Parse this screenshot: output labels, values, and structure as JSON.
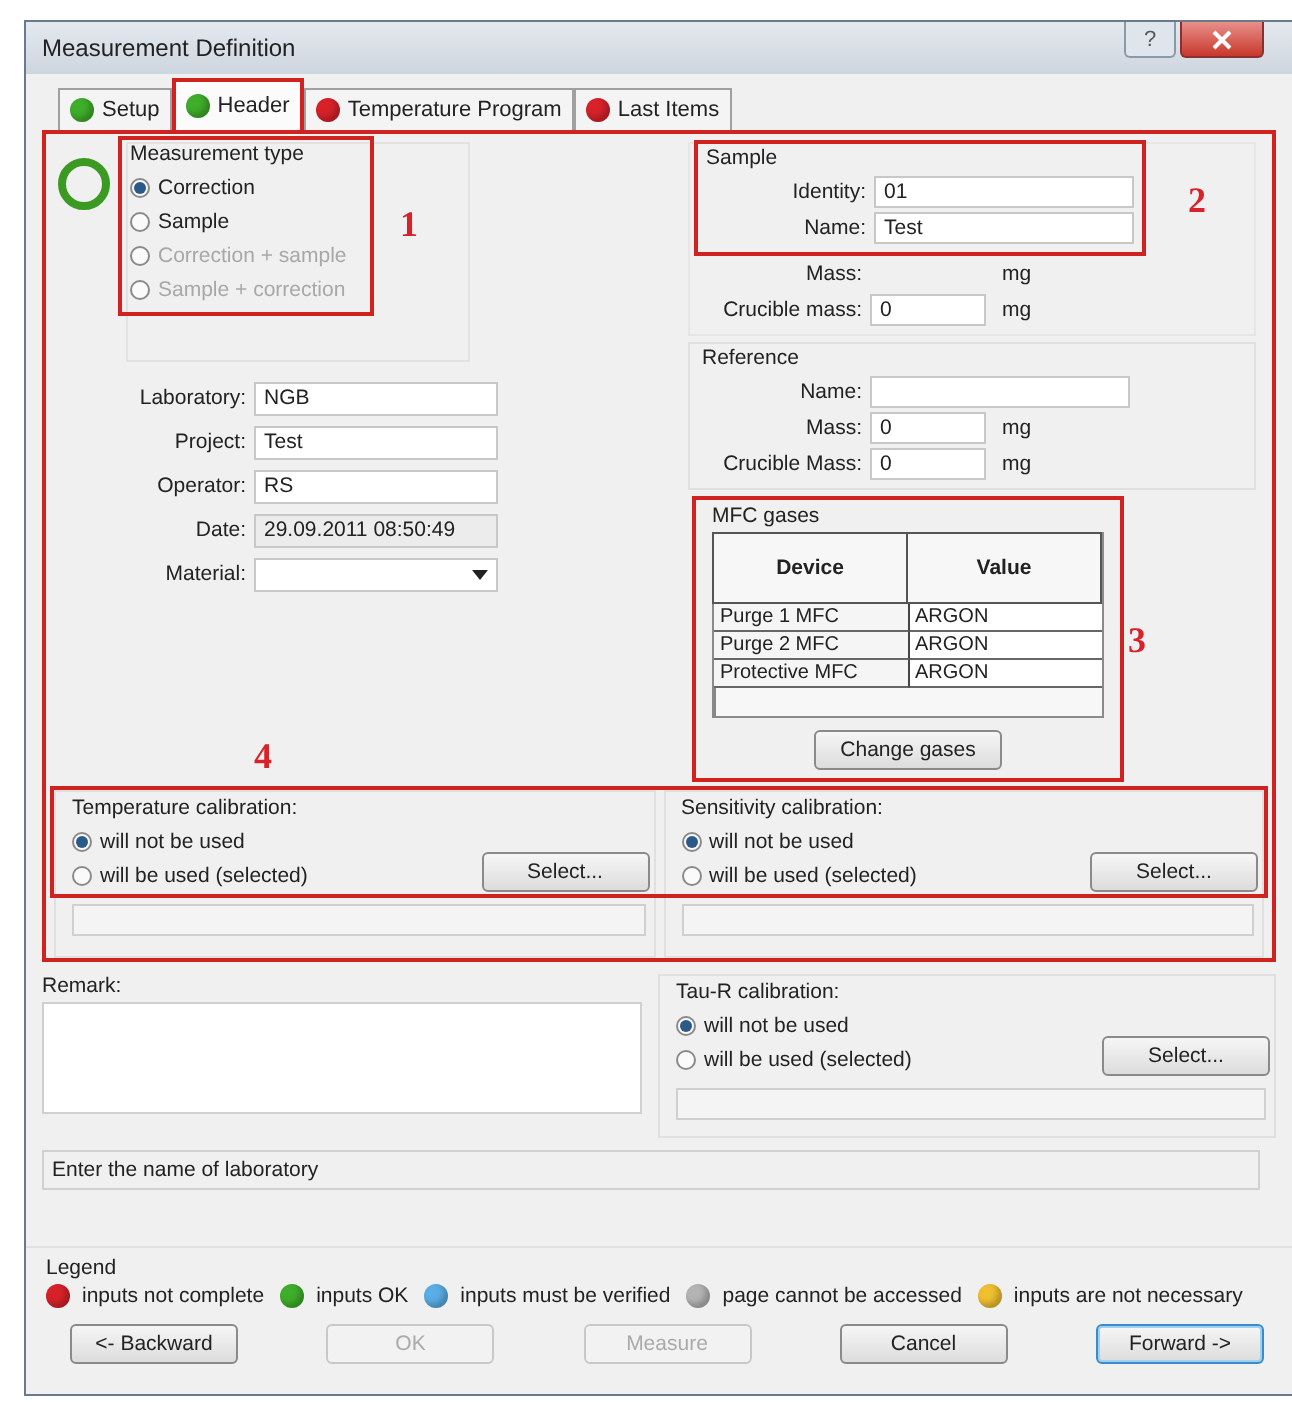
{
  "window": {
    "title": "Measurement Definition",
    "help": "?"
  },
  "tabs": [
    {
      "label": "Setup",
      "selected": false,
      "color": "#3fae2a"
    },
    {
      "label": "Header",
      "selected": true,
      "color": "#3fae2a"
    },
    {
      "label": "Temperature Program",
      "selected": false,
      "color": "#d8222a"
    },
    {
      "label": "Last Items",
      "selected": false,
      "color": "#d8222a"
    }
  ],
  "measurement_type": {
    "title": "Measurement type",
    "annotation": "1",
    "options": [
      {
        "label": "Correction",
        "selected": true,
        "disabled": false
      },
      {
        "label": "Sample",
        "selected": false,
        "disabled": false
      },
      {
        "label": "Correction + sample",
        "selected": false,
        "disabled": true
      },
      {
        "label": "Sample + correction",
        "selected": false,
        "disabled": true
      }
    ]
  },
  "header_fields": [
    {
      "label": "Laboratory:",
      "value": "NGB",
      "kind": "text"
    },
    {
      "label": "Project:",
      "value": "Test",
      "kind": "text"
    },
    {
      "label": "Operator:",
      "value": "RS",
      "kind": "text"
    },
    {
      "label": "Date:",
      "value": "29.09.2011 08:50:49",
      "kind": "readonly"
    },
    {
      "label": "Material:",
      "kind": "dropdown"
    }
  ],
  "sample": {
    "title": "Sample",
    "annotation": "2",
    "fields": [
      {
        "label": "Identity:",
        "value": "01"
      },
      {
        "label": "Name:",
        "value": "Test"
      }
    ],
    "mass_rows": [
      {
        "label": "Mass:",
        "unit": "mg",
        "kind": "blank"
      },
      {
        "label": "Crucible mass:",
        "value": "0",
        "unit": "mg",
        "kind": "input"
      }
    ]
  },
  "reference": {
    "title": "Reference",
    "name_label": "Name:",
    "mass_rows": [
      {
        "label": "Mass:",
        "value": "0",
        "unit": "mg",
        "kind": "input"
      },
      {
        "label": "Crucible Mass:",
        "value": "0",
        "unit": "mg",
        "kind": "input"
      }
    ]
  },
  "mfc_gases": {
    "title": "MFC gases",
    "annotation": "3",
    "columns": [
      "Device",
      "Value"
    ],
    "rows": [
      [
        "Purge 1 MFC",
        "ARGON"
      ],
      [
        "Purge 2 MFC",
        "ARGON"
      ],
      [
        "Protective MFC",
        "ARGON"
      ]
    ],
    "button": "Change gases"
  },
  "calibration_annotation": "4",
  "calibrations": [
    {
      "title": "Temperature calibration:",
      "options": [
        {
          "label": "will not be used",
          "selected": true
        },
        {
          "label": "will be used (selected)",
          "selected": false
        }
      ],
      "button": "Select..."
    },
    {
      "title": "Sensitivity calibration:",
      "options": [
        {
          "label": "will not be used",
          "selected": true
        },
        {
          "label": "will be used (selected)",
          "selected": false
        }
      ],
      "button": "Select..."
    }
  ],
  "remark": {
    "label": "Remark:"
  },
  "tau_r": {
    "title": "Tau-R calibration:",
    "options": [
      {
        "label": "will not be used",
        "selected": true
      },
      {
        "label": "will be used (selected)",
        "selected": false
      }
    ],
    "button": "Select..."
  },
  "hint": "Enter the name of laboratory",
  "legend": {
    "title": "Legend",
    "items": [
      {
        "label": "inputs not complete",
        "color": "#d8222a"
      },
      {
        "label": "inputs OK",
        "color": "#3fae2a"
      },
      {
        "label": "inputs must be verified",
        "color": "#5aaee6"
      },
      {
        "label": "page cannot be accessed",
        "color": "#b4b4b4"
      },
      {
        "label": "inputs are not necessary",
        "color": "#f0c030"
      }
    ]
  },
  "buttons": [
    {
      "label": "<- Backward",
      "disabled": false,
      "focused": false
    },
    {
      "label": "OK",
      "disabled": true,
      "focused": false
    },
    {
      "label": "Measure",
      "disabled": true,
      "focused": false
    },
    {
      "label": "Cancel",
      "disabled": false,
      "focused": false
    },
    {
      "label": "Forward ->",
      "disabled": false,
      "focused": true
    }
  ]
}
